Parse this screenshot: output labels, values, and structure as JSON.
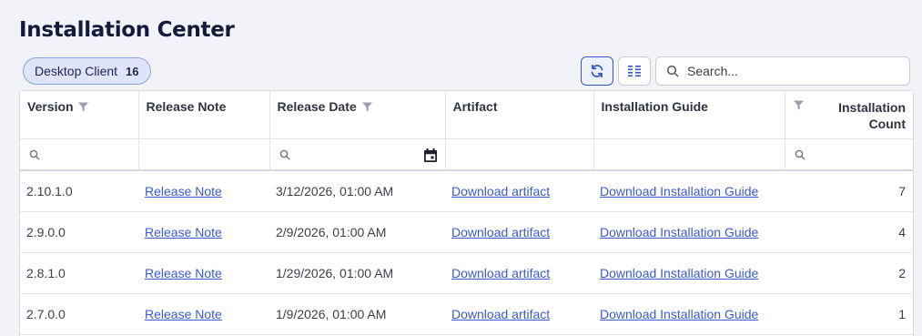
{
  "page": {
    "title": "Installation Center"
  },
  "tab": {
    "label": "Desktop Client",
    "count": "16"
  },
  "toolbar": {
    "search_placeholder": "Search..."
  },
  "columns": [
    "Version",
    "Release Note",
    "Release Date",
    "Artifact",
    "Installation Guide",
    "Installation Count"
  ],
  "rows": [
    {
      "version": "2.10.1.0",
      "release_note": "Release Note",
      "release_date": "3/12/2026, 01:00 AM",
      "artifact": "Download artifact",
      "guide": "Download Installation Guide",
      "count": "7"
    },
    {
      "version": "2.9.0.0",
      "release_note": "Release Note",
      "release_date": "2/9/2026, 01:00 AM",
      "artifact": "Download artifact",
      "guide": "Download Installation Guide",
      "count": "4"
    },
    {
      "version": "2.8.1.0",
      "release_note": "Release Note",
      "release_date": "1/29/2026, 01:00 AM",
      "artifact": "Download artifact",
      "guide": "Download Installation Guide",
      "count": "2"
    },
    {
      "version": "2.7.0.0",
      "release_note": "Release Note",
      "release_date": "1/9/2026, 01:00 AM",
      "artifact": "Download artifact",
      "guide": "Download Installation Guide",
      "count": "1"
    }
  ],
  "icons": {
    "refresh": "refresh-icon",
    "columns": "columns-icon",
    "search": "search-icon",
    "filter": "filter-icon",
    "calendar": "calendar-icon"
  },
  "colors": {
    "accent": "#3a56c9",
    "link": "#3a5bd0",
    "chip_bg": "#dfe5f8",
    "page_bg": "#f1f3f9"
  }
}
